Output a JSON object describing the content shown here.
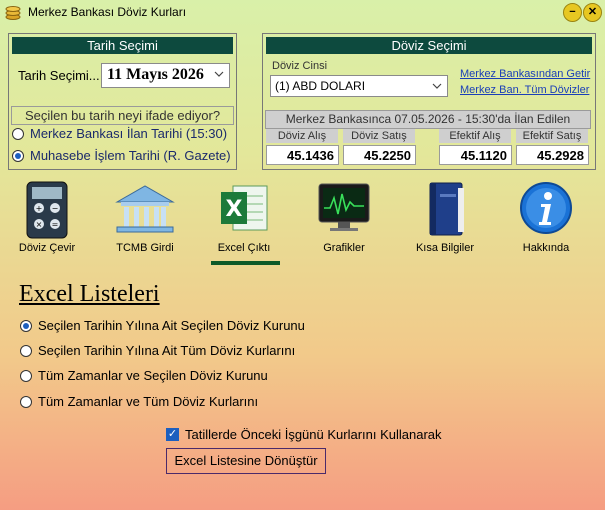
{
  "window": {
    "title": "Merkez Bankası Döviz Kurları"
  },
  "date_section": {
    "header": "Tarih Seçimi",
    "label": "Tarih Seçimi...",
    "date_value": "11  Mayıs  2026",
    "question": "Seçilen bu tarih neyi ifade ediyor?",
    "options": [
      {
        "label": "Merkez Bankası İlan Tarihi (15:30)",
        "selected": false
      },
      {
        "label": "Muhasebe İşlem Tarihi (R. Gazete)",
        "selected": true
      }
    ]
  },
  "currency_section": {
    "header": "Döviz Seçimi",
    "cins_label": "Döviz Cinsi",
    "selected": "(1) ABD DOLARI",
    "link_get": "Merkez Bankasından Getir",
    "link_all": "Merkez Ban. Tüm Dövizler",
    "announcement": "Merkez Bankasınca 07.05.2026 - 15:30'da İlan Edilen",
    "rates": [
      {
        "label": "Döviz Alış",
        "value": "45.1436"
      },
      {
        "label": "Döviz Satış",
        "value": "45.2250"
      },
      {
        "label": "Efektif Alış",
        "value": "45.1120"
      },
      {
        "label": "Efektif Satış",
        "value": "45.2928"
      }
    ]
  },
  "toolbar": [
    {
      "label": "Döviz Çevir",
      "icon": "calculator-icon"
    },
    {
      "label": "TCMB Girdi",
      "icon": "bank-icon"
    },
    {
      "label": "Excel Çıktı",
      "icon": "excel-icon",
      "active": true
    },
    {
      "label": "Grafikler",
      "icon": "chart-monitor-icon"
    },
    {
      "label": "Kısa Bilgiler",
      "icon": "book-icon"
    },
    {
      "label": "Hakkında",
      "icon": "info-icon"
    }
  ],
  "excel": {
    "title": "Excel Listeleri",
    "options": [
      {
        "label": "Seçilen Tarihin Yılına Ait Seçilen Döviz Kurunu",
        "selected": true
      },
      {
        "label": "Seçilen Tarihin Yılına Ait Tüm Döviz Kurlarını",
        "selected": false
      },
      {
        "label": "Tüm Zamanlar ve Seçilen Döviz Kurunu",
        "selected": false
      },
      {
        "label": "Tüm Zamanlar ve Tüm Döviz Kurlarını",
        "selected": false
      }
    ],
    "holiday_checkbox": {
      "label": "Tatillerde Önceki İşgünü Kurlarını Kullanarak",
      "checked": true
    },
    "convert_button": "Excel Listesine Dönüştür"
  },
  "colors": {
    "header_bg": "#0d4a3e",
    "link": "#1a3fb8",
    "radio": "#1d5fbf",
    "active_underline": "#0d5a28"
  }
}
